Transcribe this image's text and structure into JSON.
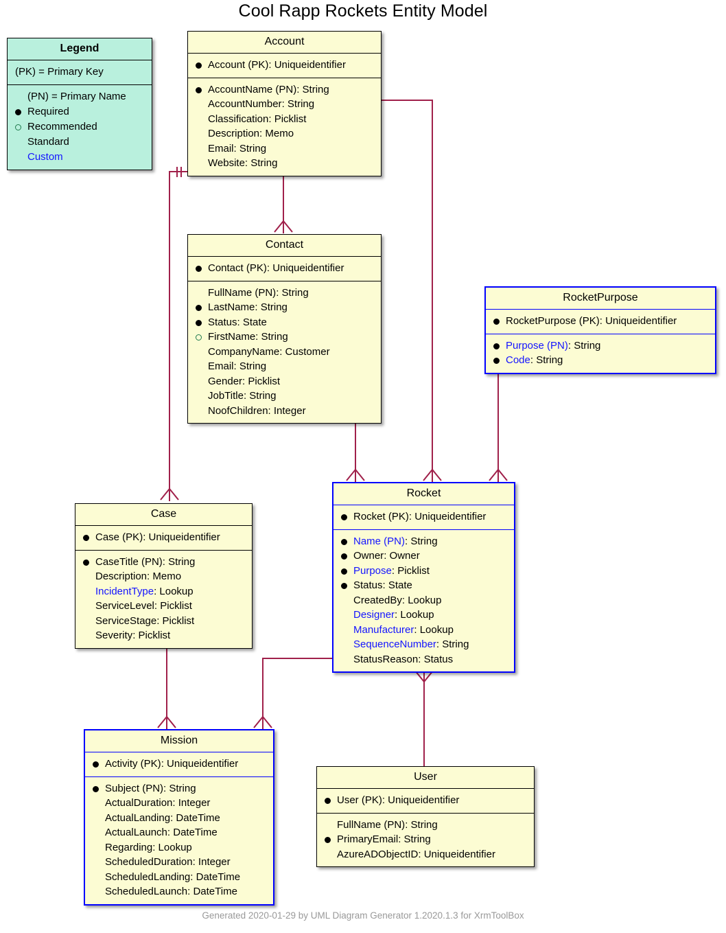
{
  "title": "Cool Rapp Rockets Entity Model",
  "footer": "Generated 2020-01-29 by UML Diagram Generator 1.2020.1.3 for XrmToolBox",
  "colors": {
    "entity_fill": "#fcfcd3",
    "entity_border": "#000000",
    "custom_border": "#0000ff",
    "custom_text": "#1414ff",
    "legend_fill": "#b9f0dd",
    "connector": "#a0204a",
    "footer_text": "#999999",
    "recommended_ring": "#1f7a4d"
  },
  "legend": {
    "title": "Legend",
    "rows_section1": [
      {
        "bullet": "none",
        "text": "(PK) = Primary Key",
        "style": "flush"
      }
    ],
    "rows_section2": [
      {
        "bullet": "none",
        "text": "(PN) = Primary Name",
        "style": "normal"
      },
      {
        "bullet": "required",
        "text": "Required",
        "style": "normal"
      },
      {
        "bullet": "recommended",
        "text": "Recommended",
        "style": "normal"
      },
      {
        "bullet": "none",
        "text": "Standard",
        "style": "normal"
      },
      {
        "bullet": "none",
        "text": "Custom",
        "style": "custom"
      }
    ]
  },
  "entities": {
    "account": {
      "name": "Account",
      "custom": false,
      "pk": [
        {
          "bullet": "required",
          "field": "Account (PK)",
          "type": "Uniqueidentifier",
          "custom": false
        }
      ],
      "attrs": [
        {
          "bullet": "required",
          "field": "AccountName (PN)",
          "type": "String",
          "custom": false
        },
        {
          "bullet": "none",
          "field": "AccountNumber",
          "type": "String",
          "custom": false
        },
        {
          "bullet": "none",
          "field": "Classification",
          "type": "Picklist",
          "custom": false
        },
        {
          "bullet": "none",
          "field": "Description",
          "type": "Memo",
          "custom": false
        },
        {
          "bullet": "none",
          "field": "Email",
          "type": "String",
          "custom": false
        },
        {
          "bullet": "none",
          "field": "Website",
          "type": "String",
          "custom": false
        }
      ]
    },
    "contact": {
      "name": "Contact",
      "custom": false,
      "pk": [
        {
          "bullet": "required",
          "field": "Contact (PK)",
          "type": "Uniqueidentifier",
          "custom": false
        }
      ],
      "attrs": [
        {
          "bullet": "none",
          "field": "FullName (PN)",
          "type": "String",
          "custom": false
        },
        {
          "bullet": "required",
          "field": "LastName",
          "type": "String",
          "custom": false
        },
        {
          "bullet": "required",
          "field": "Status",
          "type": "State",
          "custom": false
        },
        {
          "bullet": "recommended",
          "field": "FirstName",
          "type": "String",
          "custom": false
        },
        {
          "bullet": "none",
          "field": "CompanyName",
          "type": "Customer",
          "custom": false
        },
        {
          "bullet": "none",
          "field": "Email",
          "type": "String",
          "custom": false
        },
        {
          "bullet": "none",
          "field": "Gender",
          "type": "Picklist",
          "custom": false
        },
        {
          "bullet": "none",
          "field": "JobTitle",
          "type": "String",
          "custom": false
        },
        {
          "bullet": "none",
          "field": "NoofChildren",
          "type": "Integer",
          "custom": false
        }
      ]
    },
    "rocketpurpose": {
      "name": "RocketPurpose",
      "custom": true,
      "pk": [
        {
          "bullet": "required",
          "field": "RocketPurpose (PK)",
          "type": "Uniqueidentifier",
          "custom": false
        }
      ],
      "attrs": [
        {
          "bullet": "required",
          "field": "Purpose (PN)",
          "type": "String",
          "custom": true
        },
        {
          "bullet": "required",
          "field": "Code",
          "type": "String",
          "custom": true
        }
      ]
    },
    "case": {
      "name": "Case",
      "custom": false,
      "pk": [
        {
          "bullet": "required",
          "field": "Case (PK)",
          "type": "Uniqueidentifier",
          "custom": false
        }
      ],
      "attrs": [
        {
          "bullet": "required",
          "field": "CaseTitle (PN)",
          "type": "String",
          "custom": false
        },
        {
          "bullet": "none",
          "field": "Description",
          "type": "Memo",
          "custom": false
        },
        {
          "bullet": "none",
          "field": "IncidentType",
          "type": "Lookup",
          "custom": true
        },
        {
          "bullet": "none",
          "field": "ServiceLevel",
          "type": "Picklist",
          "custom": false
        },
        {
          "bullet": "none",
          "field": "ServiceStage",
          "type": "Picklist",
          "custom": false
        },
        {
          "bullet": "none",
          "field": "Severity",
          "type": "Picklist",
          "custom": false
        }
      ]
    },
    "rocket": {
      "name": "Rocket",
      "custom": true,
      "pk": [
        {
          "bullet": "required",
          "field": "Rocket (PK)",
          "type": "Uniqueidentifier",
          "custom": false
        }
      ],
      "attrs": [
        {
          "bullet": "required",
          "field": "Name (PN)",
          "type": "String",
          "custom": true
        },
        {
          "bullet": "required",
          "field": "Owner",
          "type": "Owner",
          "custom": false
        },
        {
          "bullet": "required",
          "field": "Purpose",
          "type": "Picklist",
          "custom": true
        },
        {
          "bullet": "required",
          "field": "Status",
          "type": "State",
          "custom": false
        },
        {
          "bullet": "none",
          "field": "CreatedBy",
          "type": "Lookup",
          "custom": false
        },
        {
          "bullet": "none",
          "field": "Designer",
          "type": "Lookup",
          "custom": true
        },
        {
          "bullet": "none",
          "field": "Manufacturer",
          "type": "Lookup",
          "custom": true
        },
        {
          "bullet": "none",
          "field": "SequenceNumber",
          "type": "String",
          "custom": true
        },
        {
          "bullet": "none",
          "field": "StatusReason",
          "type": "Status",
          "custom": false
        }
      ]
    },
    "mission": {
      "name": "Mission",
      "custom": true,
      "pk": [
        {
          "bullet": "required",
          "field": "Activity (PK)",
          "type": "Uniqueidentifier",
          "custom": false
        }
      ],
      "attrs": [
        {
          "bullet": "required",
          "field": "Subject (PN)",
          "type": "String",
          "custom": false
        },
        {
          "bullet": "none",
          "field": "ActualDuration",
          "type": "Integer",
          "custom": false
        },
        {
          "bullet": "none",
          "field": "ActualLanding",
          "type": "DateTime",
          "custom": false
        },
        {
          "bullet": "none",
          "field": "ActualLaunch",
          "type": "DateTime",
          "custom": false
        },
        {
          "bullet": "none",
          "field": "Regarding",
          "type": "Lookup",
          "custom": false
        },
        {
          "bullet": "none",
          "field": "ScheduledDuration",
          "type": "Integer",
          "custom": false
        },
        {
          "bullet": "none",
          "field": "ScheduledLanding",
          "type": "DateTime",
          "custom": false
        },
        {
          "bullet": "none",
          "field": "ScheduledLaunch",
          "type": "DateTime",
          "custom": false
        }
      ]
    },
    "user": {
      "name": "User",
      "custom": false,
      "pk": [
        {
          "bullet": "required",
          "field": "User (PK)",
          "type": "Uniqueidentifier",
          "custom": false
        }
      ],
      "attrs": [
        {
          "bullet": "none",
          "field": "FullName (PN)",
          "type": "String",
          "custom": false
        },
        {
          "bullet": "required",
          "field": "PrimaryEmail",
          "type": "String",
          "custom": false
        },
        {
          "bullet": "none",
          "field": "AzureADObjectID",
          "type": "Uniqueidentifier",
          "custom": false
        }
      ]
    }
  },
  "relationships": [
    {
      "from": "Account",
      "to": "Contact",
      "cardinality": "one-to-many"
    },
    {
      "from": "Account",
      "to": "Rocket",
      "cardinality": "one-to-many"
    },
    {
      "from": "Account",
      "to": "Case",
      "cardinality": "one-to-many"
    },
    {
      "from": "Contact",
      "to": "Rocket",
      "cardinality": "one-to-many"
    },
    {
      "from": "RocketPurpose",
      "to": "Rocket",
      "cardinality": "one-to-many"
    },
    {
      "from": "Case",
      "to": "Mission",
      "cardinality": "one-to-many"
    },
    {
      "from": "Rocket",
      "to": "Mission",
      "cardinality": "one-to-many"
    },
    {
      "from": "User",
      "to": "Rocket",
      "cardinality": "one-to-many"
    }
  ]
}
